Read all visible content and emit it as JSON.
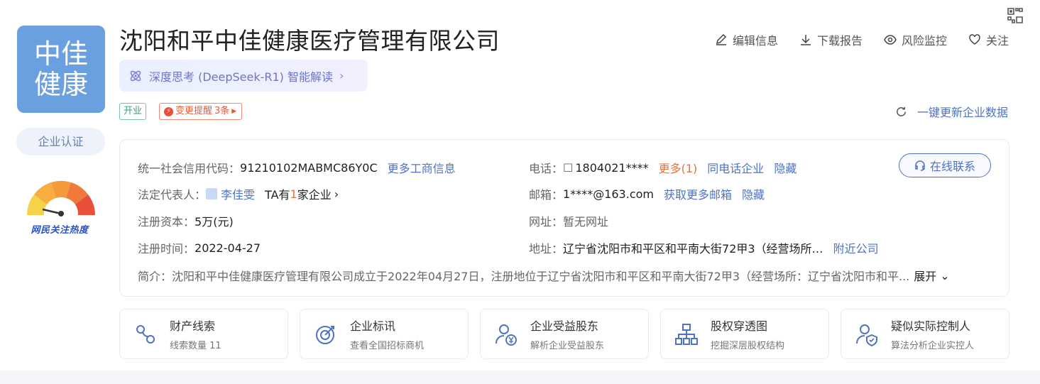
{
  "company": {
    "logo_line1": "中佳",
    "logo_line2": "健康",
    "name": "沈阳和平中佳健康医疗管理有限公司",
    "certify_label": "企业认证",
    "heat_label": "网民关注热度"
  },
  "ai": {
    "label": "深度思考 (DeepSeek-R1) 智能解读",
    "chevron": "›"
  },
  "tags": {
    "status": "开业",
    "change_prefix": "变更提醒",
    "change_count": "3条"
  },
  "actions": {
    "edit": "编辑信息",
    "download": "下载报告",
    "risk": "风险监控",
    "follow": "关注"
  },
  "refresh_label": "一键更新企业数据",
  "info": {
    "credit_code_label": "统一社会信用代码：",
    "credit_code_value": "91210102MABMC86Y0C",
    "more_biz_link": "更多工商信息",
    "legal_rep_label": "法定代表人：",
    "legal_rep_name": "李佳雯",
    "legal_rep_suffix_a": "TA有",
    "legal_rep_count": "1",
    "legal_rep_suffix_b": "家企业",
    "capital_label": "注册资本：",
    "capital_value": "5万(元)",
    "reg_time_label": "注册时间：",
    "reg_time_value": "2022-04-27",
    "phone_label": "电话：",
    "phone_value": "1804021****",
    "phone_more": "更多(1)",
    "phone_same": "同电话企业",
    "phone_hide": "隐藏",
    "email_label": "邮箱：",
    "email_value": "1****@163.com",
    "email_more": "获取更多邮箱",
    "email_hide": "隐藏",
    "site_label": "网址：",
    "site_value": "暂无网址",
    "address_label": "地址：",
    "address_value": "辽宁省沈阳市和平区和平南大街72甲3（经营场所…",
    "address_nearby": "附近公司",
    "intro_label": "简介：",
    "intro_value": "沈阳和平中佳健康医疗管理有限公司成立于2022年04月27日，注册地位于辽宁省沈阳市和平区和平南大街72甲3（经营场所：辽宁省沈阳市和平...",
    "expand_label": "展开",
    "online_contact": "在线联系"
  },
  "tiles": [
    {
      "title": "财产线索",
      "sub": "线索数量 11",
      "icon": "property-clue-icon"
    },
    {
      "title": "企业标讯",
      "sub": "查看全国招标商机",
      "icon": "bid-target-icon"
    },
    {
      "title": "企业受益股东",
      "sub": "解析企业受益股东",
      "icon": "beneficiary-icon"
    },
    {
      "title": "股权穿透图",
      "sub": "挖掘深层股权结构",
      "icon": "equity-tree-icon"
    },
    {
      "title": "疑似实际控制人",
      "sub": "算法分析企业实控人",
      "icon": "controller-icon"
    }
  ],
  "colors": {
    "brand_blue": "#4e73c4",
    "logo_bg": "#6a9fe0",
    "alert_orange": "#e8703a"
  }
}
